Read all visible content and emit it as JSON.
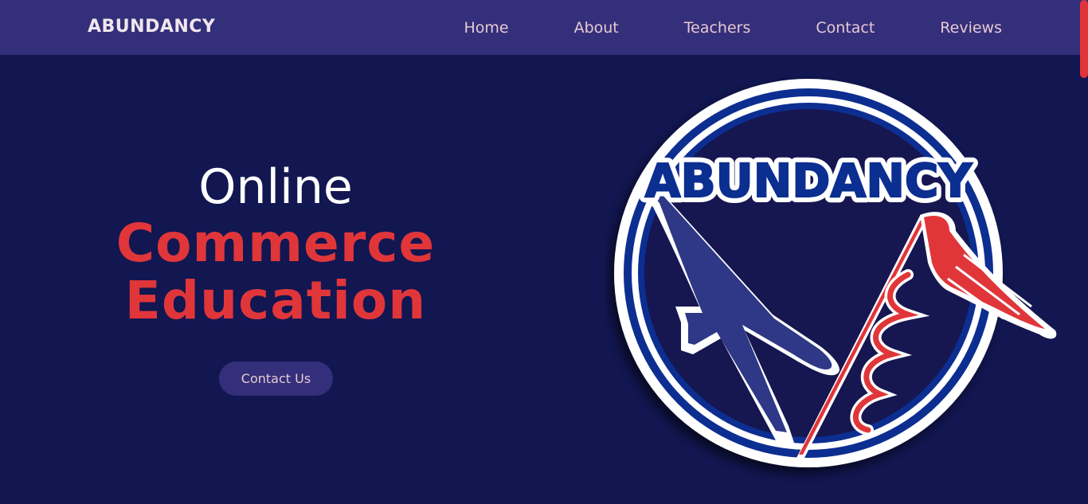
{
  "navbar": {
    "brand": "ABUNDANCY",
    "links": [
      "Home",
      "About",
      "Teachers",
      "Contact",
      "Reviews"
    ]
  },
  "hero": {
    "line1": "Online",
    "line2": "Commerce",
    "line3": "Education",
    "cta_label": "Contact Us"
  },
  "logo": {
    "text": "ABUNDANCY",
    "icons": [
      "airplane-icon",
      "caduceus-icon"
    ]
  },
  "colors": {
    "background": "#121651",
    "navbar": "#332f7a",
    "accent_red": "#e0363a",
    "nav_text": "#e8c9d2",
    "logo_blue": "#0b2e91"
  }
}
